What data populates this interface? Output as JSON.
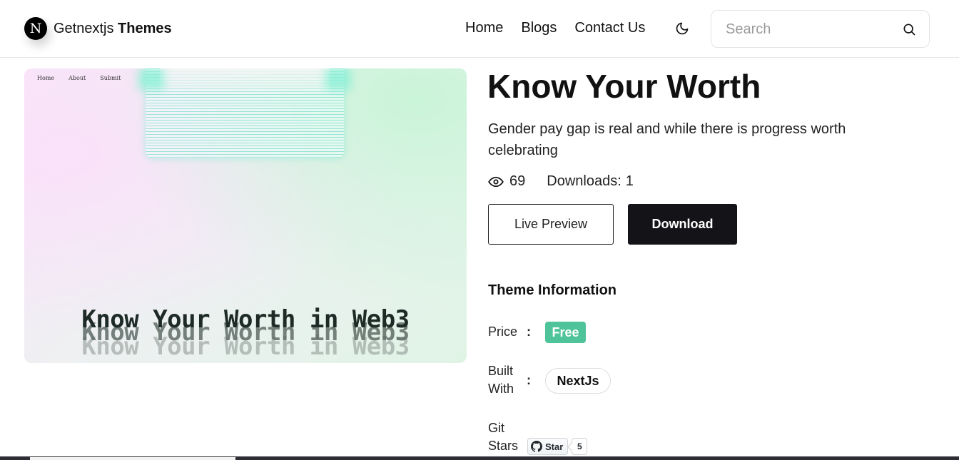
{
  "header": {
    "logo_letter": "N",
    "brand_light": "Getnextjs",
    "brand_bold": "Themes",
    "nav": [
      {
        "label": "Home"
      },
      {
        "label": "Blogs"
      },
      {
        "label": "Contact Us"
      }
    ],
    "theme_toggle_icon": "moon-icon",
    "search": {
      "placeholder": "Search",
      "value": "",
      "icon": "search-icon"
    }
  },
  "preview": {
    "mini_nav": [
      "Home",
      "About",
      "Submit"
    ],
    "hero_text": "Know Your Worth in Web3"
  },
  "theme": {
    "title": "Know Your Worth",
    "description": "Gender pay gap is real and while there is progress worth celebrating",
    "views": "69",
    "downloads_label": "Downloads:",
    "downloads_value": "1",
    "live_preview_label": "Live Preview",
    "download_label": "Download"
  },
  "info": {
    "title": "Theme Information",
    "price_label": "Price",
    "price_value": "Free",
    "built_label_1": "Built",
    "built_label_2": "With",
    "built_value": "NextJs",
    "git_label_1": "Git",
    "git_label_2": "Stars",
    "star_label": "Star",
    "star_count": "5",
    "separator": ":"
  },
  "colors": {
    "accent_free": "#4fc39a",
    "download_button": "#141418"
  }
}
